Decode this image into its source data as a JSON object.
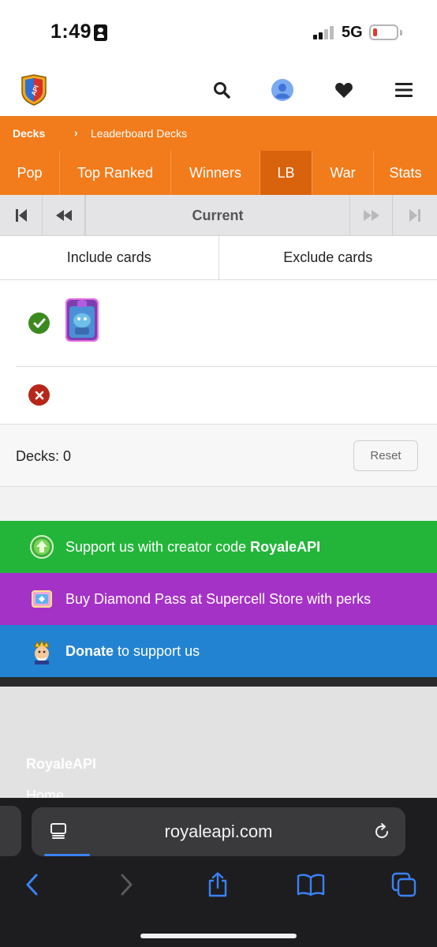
{
  "status_bar": {
    "time": "1:49",
    "network": "5G"
  },
  "header": {
    "logo_text": "API",
    "search_icon": "search-icon",
    "avatar_icon": "user-avatar-icon",
    "favorites_icon": "heart-icon",
    "menu_icon": "hamburger-menu-icon"
  },
  "breadcrumb": {
    "root": "Decks",
    "separator": "›",
    "current": "Leaderboard Decks"
  },
  "tabs": [
    {
      "label": "Pop",
      "active": false
    },
    {
      "label": "Top Ranked",
      "active": false
    },
    {
      "label": "Winners",
      "active": false
    },
    {
      "label": "LB",
      "active": true
    },
    {
      "label": "War",
      "active": false
    },
    {
      "label": "Stats",
      "active": false
    }
  ],
  "pager": {
    "current_label": "Current",
    "first_icon": "skip-first-icon",
    "prev_icon": "rewind-icon",
    "next_icon": "fast-forward-icon",
    "last_icon": "skip-last-icon"
  },
  "filter": {
    "include_label": "Include cards",
    "exclude_label": "Exclude cards",
    "include_icon": "check-circle-icon",
    "exclude_icon": "x-circle-icon",
    "included_card": "card-icon"
  },
  "decks": {
    "count_label": "Decks: 0",
    "reset_label": "Reset"
  },
  "promos": [
    {
      "prefix": "Support us with creator code ",
      "bold": "RoyaleAPI",
      "suffix": "",
      "color": "#23b53a",
      "icon": "upvote-icon"
    },
    {
      "prefix": "Buy Diamond Pass at Supercell Store with perks",
      "bold": "",
      "suffix": "",
      "color": "#a532c6",
      "icon": "pass-icon"
    },
    {
      "prefix": "",
      "bold": "Donate",
      "suffix": " to support us",
      "color": "#2383d3",
      "icon": "king-icon"
    }
  ],
  "footer": {
    "brand": "RoyaleAPI",
    "home": "Home"
  },
  "safari": {
    "url": "royaleapi.com",
    "reader_icon": "reader-icon",
    "reload_icon": "reload-icon",
    "back_icon": "back-icon",
    "forward_icon": "forward-icon",
    "share_icon": "share-icon",
    "bookmarks_icon": "bookmarks-icon",
    "tabs_icon": "tabs-icon"
  },
  "colors": {
    "orange": "#f27b1b",
    "active_tab": "#d9620c",
    "check_green": "#3b8a1f",
    "x_red": "#b8261a"
  }
}
